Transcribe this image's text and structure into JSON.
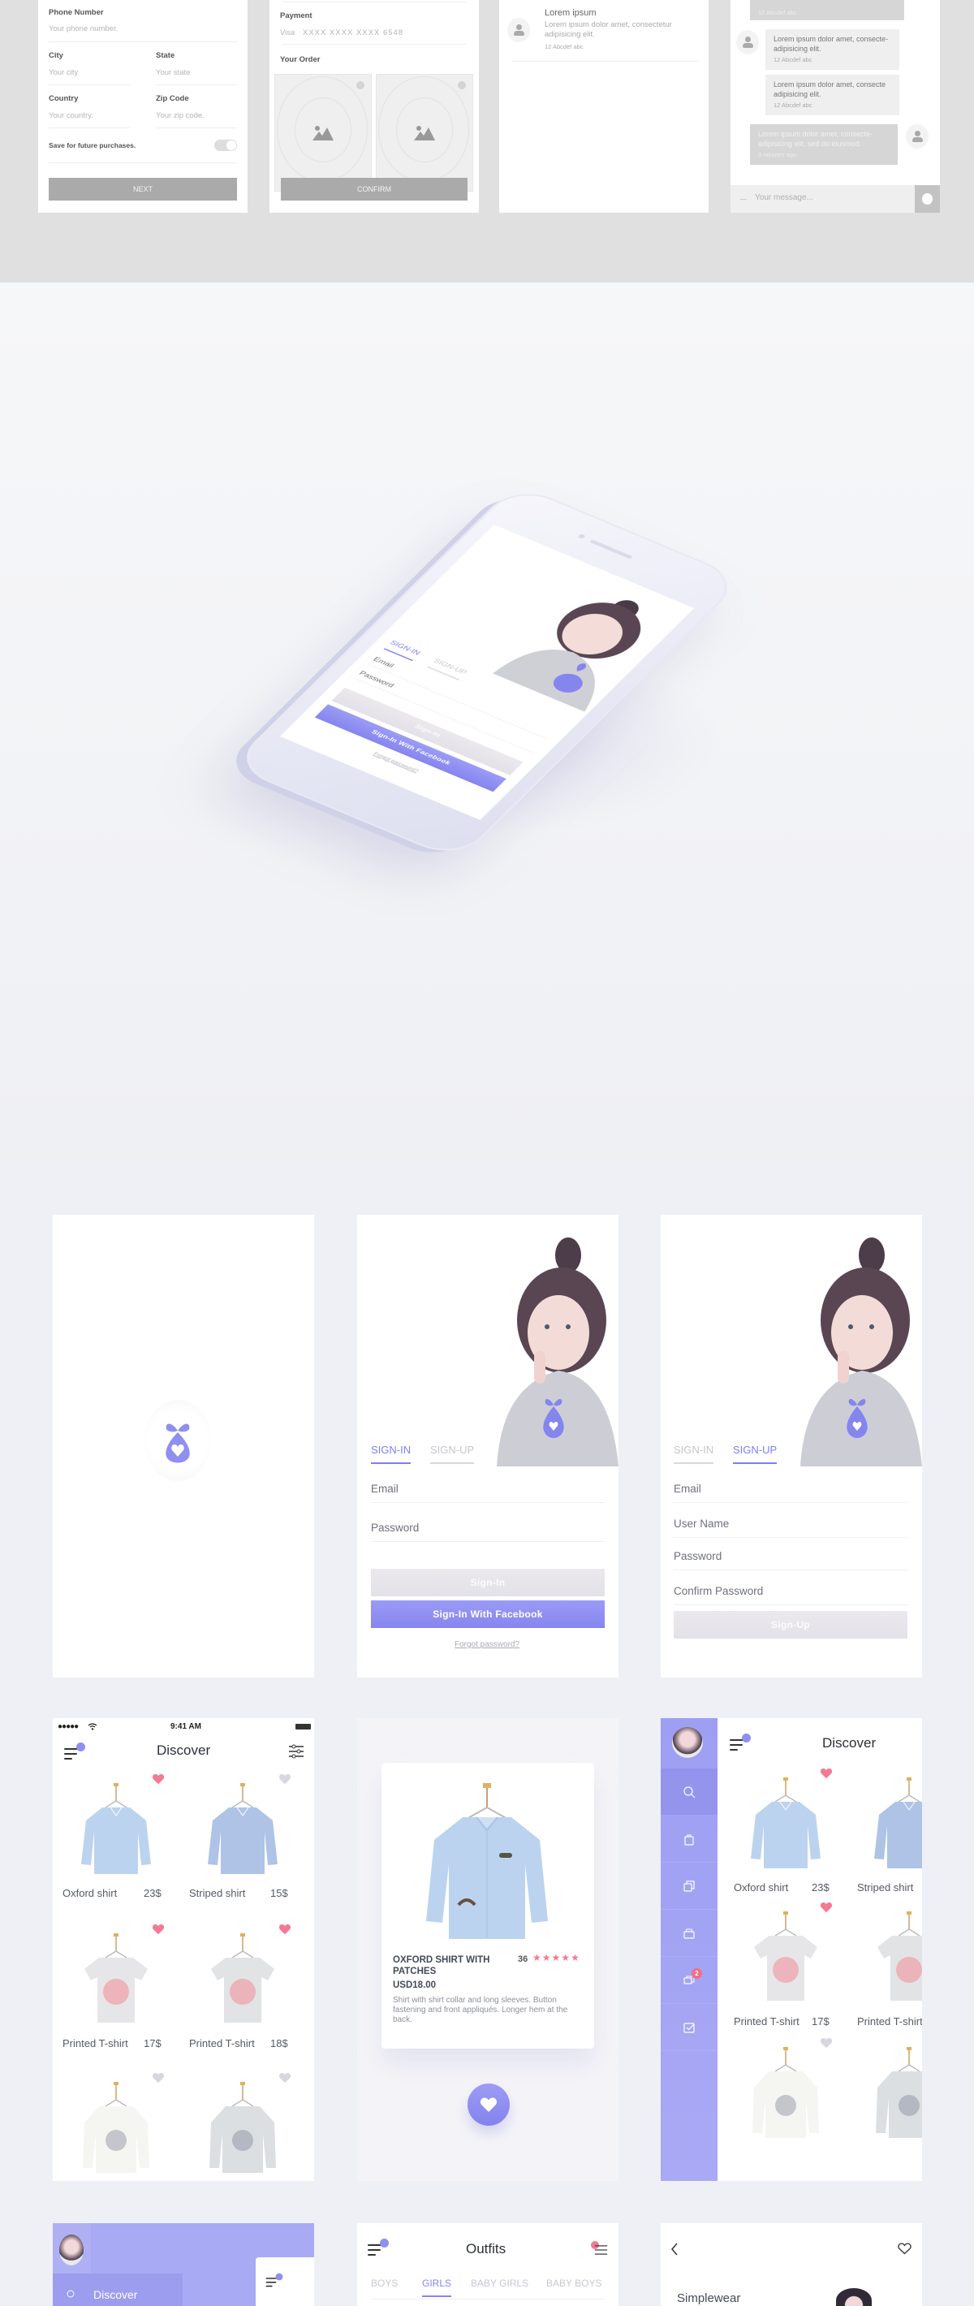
{
  "wireframes": {
    "address_form": {
      "phone_label": "Phone Number",
      "phone_placeholder": "Your phone number.",
      "city_label": "City",
      "city_placeholder": "Your city",
      "state_label": "State",
      "state_placeholder": "Your state",
      "country_label": "Country",
      "country_placeholder": "Your country.",
      "zip_label": "Zip Code",
      "zip_placeholder": "Your zip code.",
      "save_label": "Save for future purchases.",
      "save_toggle_on": true,
      "next_button": "NEXT"
    },
    "checkout": {
      "payment_label": "Payment",
      "card_brand": "Visa",
      "card_number": "XXXX XXXX XXXX  6548",
      "order_label": "Your Order",
      "confirm_button": "CONFIRM"
    },
    "messages": {
      "item_title": "Lorem ipsum",
      "item_text": "Lorem ipsum dolor amet, consectetur adipisicing elit.",
      "item_time": "12 Abcdef abc"
    },
    "chat": {
      "top_time": "12 Abcdef abc",
      "bubbles": [
        {
          "text": "Lorem ipsum dolor amet, consecte-adipisicing elit.",
          "time": "12 Abcdef abc"
        },
        {
          "text": "Lorem ipsum dolor amet, consecte adipisicing elit.",
          "time": "12 Abcdef abc"
        },
        {
          "text": "Lorem ipsum dolor  amet, consecte-adipisicing elit, sed do eiusmod.",
          "time": "3 minutes ago"
        }
      ],
      "input_placeholder": "Your message..."
    }
  },
  "auth": {
    "tab_signin": "SIGN-IN",
    "tab_signup": "SIGN-UP",
    "email": "Email",
    "username": "User Name",
    "password": "Password",
    "confirm_password": "Confirm Password",
    "signin_button": "Sign-In",
    "facebook_button": "Sign-In With Facebook",
    "forgot_link": "Forgot password?",
    "signup_button": "Sign-Up"
  },
  "discover": {
    "status_time": "9:41 AM",
    "title": "Discover",
    "products": [
      {
        "name": "Oxford shirt",
        "price": "23$",
        "liked": true,
        "kind": "shirt",
        "color": "#bcd3ef"
      },
      {
        "name": "Striped shirt",
        "price": "15$",
        "liked": false,
        "kind": "shirt",
        "color": "#aec3e6"
      },
      {
        "name": "Printed T-shirt",
        "price": "17$",
        "liked": true,
        "kind": "tee",
        "color": "#e6e6e8"
      },
      {
        "name": "Printed T-shirt",
        "price": "18$",
        "liked": true,
        "kind": "tee",
        "color": "#e2e3e4"
      },
      {
        "name": "",
        "price": "",
        "liked": false,
        "kind": "sweat",
        "color": "#f5f5f2"
      },
      {
        "name": "",
        "price": "",
        "liked": false,
        "kind": "sweat",
        "color": "#dcdfe2"
      }
    ]
  },
  "product_detail": {
    "title": "OXFORD SHIRT WITH PATCHES",
    "reviews": "36",
    "rating": 5,
    "price": "USD18.00",
    "description": "Shirt with shirt collar and long sleeves. Button fastening and front appliqués. Longer hem at the back."
  },
  "sidebar": {
    "items": [
      "search",
      "shopping-bag",
      "collections",
      "basket",
      "chat",
      "checklist"
    ],
    "chat_badge": "2",
    "discover_label": "Discover"
  },
  "outfits": {
    "title": "Outfits",
    "tabs": [
      "BOYS",
      "GIRLS",
      "BABY GIRLS",
      "BABY BOYS"
    ],
    "active_tab": 1
  },
  "brand_detail": {
    "title": "Simplewear"
  },
  "colors": {
    "accent": "#8585ef",
    "heart_liked": "#f27a92",
    "heart_unliked": "#d6d7df",
    "star": "#f27a92"
  }
}
